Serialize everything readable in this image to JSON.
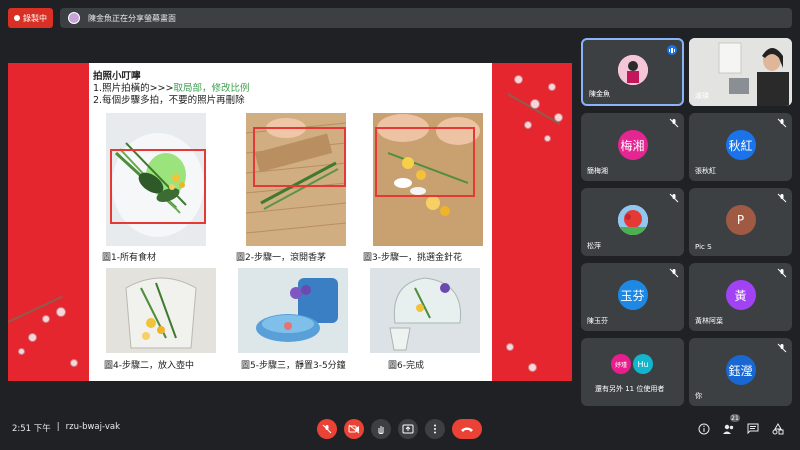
{
  "top_bar": {
    "record_label": "錄製中",
    "presenting_text": "陳金魚正在分享螢幕畫面"
  },
  "slide": {
    "title": "拍照小叮嚀",
    "line1_prefix": "1.照片拍橫的>>>",
    "line1_highlight": "取局部，修改比例",
    "line2": "2.每個步驟多拍，不要的照片再刪除",
    "captions": [
      "圖1-所有食材",
      "圖2-步驟一，滾開香茅",
      "圖3-步驟一，挑選金針花",
      "圖4-步驟二，放入壺中",
      "圖5-步驟三，靜置3-5分鐘",
      "圖6-完成"
    ]
  },
  "participants": [
    {
      "name": "陳金魚",
      "initial": "",
      "color": "#ffffff",
      "speaking": true
    },
    {
      "name": "淑瑛",
      "initial": "",
      "color": "#dfe3e6",
      "speaking": false
    },
    {
      "name": "簡梅湘",
      "initial": "梅湘",
      "color": "#e52592",
      "speaking": false
    },
    {
      "name": "張秋紅",
      "initial": "秋紅",
      "color": "#1a73e8",
      "speaking": false
    },
    {
      "name": "松萍",
      "initial": "",
      "color": "#ffffff",
      "speaking": false
    },
    {
      "name": "Pic S",
      "initial": "P",
      "color": "#a05a43",
      "speaking": false
    },
    {
      "name": "陳玉芬",
      "initial": "玉芬",
      "color": "#1e88e5",
      "speaking": false
    },
    {
      "name": "黃林阿葉",
      "initial": "黃",
      "color": "#a142f4",
      "speaking": false
    },
    {
      "name": "還有另外 11 位使用者",
      "initial": "",
      "color": "#3c4043",
      "speaking": false
    },
    {
      "name": "你",
      "initial": "鈺瀅",
      "color": "#1967d2",
      "speaking": false
    }
  ],
  "others_avatars": [
    {
      "label": "妤瑾",
      "color": "#e91e8c"
    },
    {
      "label": "Hu",
      "color": "#12b5cb"
    }
  ],
  "bottom": {
    "time": "2:51 下午",
    "separator": "|",
    "meeting_code": "rzu-bwaj-vak",
    "participants_count": "21"
  },
  "colors": {
    "background": "#202124",
    "tile": "#3c4043",
    "danger": "#ea4335",
    "active_border": "#8ab4f8"
  }
}
